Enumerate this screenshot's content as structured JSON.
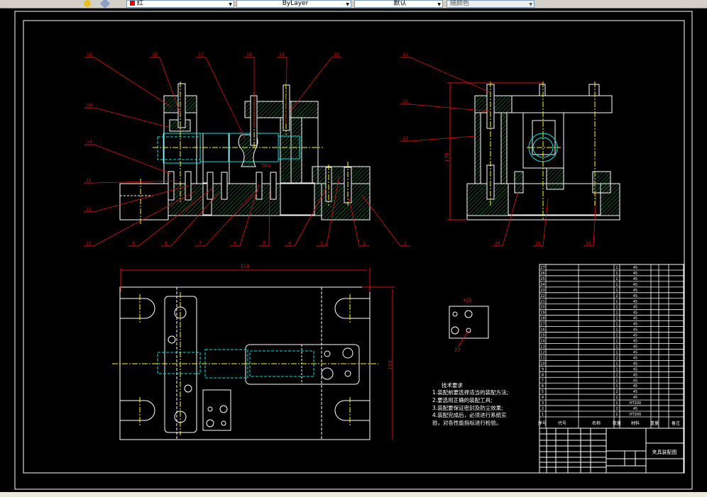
{
  "toolbar": {
    "color_value": "红",
    "linetype_value": "ByLayer",
    "lineweight_value": "默认",
    "plotstyle_value": "随颜色"
  },
  "colors": {
    "background": "#000000",
    "outline": "#ffffff",
    "hatch": "#22c35a",
    "center": "#ffff00",
    "hidden_cyan": "#00e5e5",
    "leader": "#e01010"
  },
  "front_view": {
    "balloons": [
      "15",
      "16",
      "17",
      "18",
      "19",
      "20",
      "14",
      "13",
      "12",
      "11",
      "10",
      "9",
      "8",
      "7",
      "6",
      "5",
      "4",
      "3",
      "2",
      "1"
    ],
    "note": "T8A"
  },
  "side_view": {
    "balloons": [
      "21",
      "22",
      "23",
      "24",
      "25",
      "26"
    ],
    "dimension_height": "170"
  },
  "top_view": {
    "dimension_width": "310",
    "dimension_depth": "150"
  },
  "detail_view": {
    "title": "K向",
    "balloon": "27"
  },
  "tech_requirements": {
    "title": "技术要求",
    "lines": [
      "1.装配前要选择适当的装配方法;",
      "2.要选用正确的装配工具;",
      "3.装配要保证密封及防尘效果;",
      "4.装配完成后，必须进行系统实",
      "验，对各性能指标进行检验。"
    ]
  },
  "bom": {
    "header": [
      "序号",
      "代号",
      "名称",
      "数量",
      "材料",
      "重量",
      "备注"
    ],
    "rows": [
      {
        "no": "27",
        "qty": "1",
        "mat": "45"
      },
      {
        "no": "26",
        "qty": "1",
        "mat": "45"
      },
      {
        "no": "25",
        "qty": "1",
        "mat": "45"
      },
      {
        "no": "24",
        "qty": "1",
        "mat": "45"
      },
      {
        "no": "23",
        "qty": "1",
        "mat": "45"
      },
      {
        "no": "22",
        "qty": "2",
        "mat": "45"
      },
      {
        "no": "21",
        "qty": "1",
        "mat": "45"
      },
      {
        "no": "20",
        "qty": "1",
        "mat": "45"
      },
      {
        "no": "19",
        "qty": "1",
        "mat": "45"
      },
      {
        "no": "18",
        "qty": "1",
        "mat": "45"
      },
      {
        "no": "17",
        "qty": "1",
        "mat": "45"
      },
      {
        "no": "16",
        "qty": "1",
        "mat": "45"
      },
      {
        "no": "15",
        "qty": "1",
        "mat": "45"
      },
      {
        "no": "14",
        "qty": "1",
        "mat": "45"
      },
      {
        "no": "13",
        "qty": "1",
        "mat": "45"
      },
      {
        "no": "12",
        "qty": "1",
        "mat": "45"
      },
      {
        "no": "11",
        "qty": "2",
        "mat": "45"
      },
      {
        "no": "10",
        "qty": "1",
        "mat": "45"
      },
      {
        "no": "9",
        "qty": "1",
        "mat": "45"
      },
      {
        "no": "8",
        "qty": "2",
        "mat": "45"
      },
      {
        "no": "7",
        "qty": "1",
        "mat": "45"
      },
      {
        "no": "6",
        "qty": "1",
        "mat": "45"
      },
      {
        "no": "5",
        "qty": "2",
        "mat": "45"
      },
      {
        "no": "4",
        "qty": "1",
        "mat": "45"
      },
      {
        "no": "3",
        "qty": "1",
        "mat": "HT200"
      },
      {
        "no": "2",
        "qty": "2",
        "mat": "45"
      },
      {
        "no": "1",
        "qty": "1",
        "mat": "HT200"
      }
    ],
    "title_block_name": "夹具装配图"
  }
}
